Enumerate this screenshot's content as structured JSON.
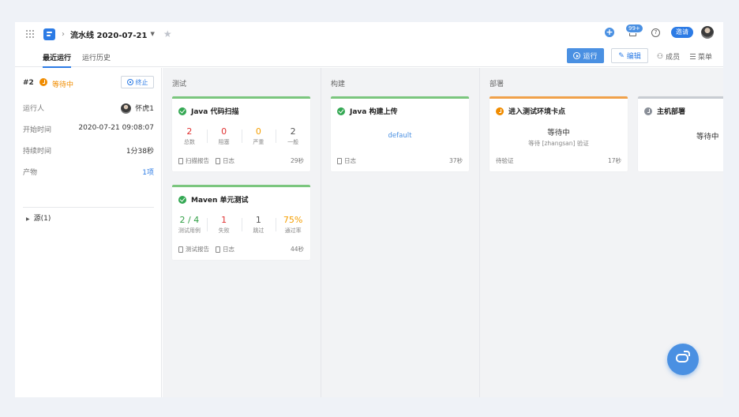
{
  "topbar": {
    "title": "流水线 2020-07-21",
    "notification_badge": "99+",
    "invite_label": "邀请"
  },
  "tabs": [
    {
      "label": "最近运行",
      "active": true
    },
    {
      "label": "运行历史",
      "active": false
    }
  ],
  "actions": {
    "run_label": "运行",
    "edit_label": "编辑",
    "members_label": "成员",
    "menu_label": "菜单"
  },
  "run": {
    "number": "#2",
    "status": "等待中",
    "stop_label": "终止",
    "info": [
      {
        "key": "运行人",
        "value": "怀虎1"
      },
      {
        "key": "开始时间",
        "value": "2020-07-21 09:08:07"
      },
      {
        "key": "持续时间",
        "value": "1分38秒"
      },
      {
        "key": "产物",
        "value": "1项"
      }
    ],
    "source_label": "源(1)"
  },
  "stages": [
    {
      "title": "测试",
      "jobs": [
        {
          "name": "Java 代码扫描",
          "stats": [
            {
              "value": "2",
              "label": "总数"
            },
            {
              "value": "0",
              "label": "阻塞"
            },
            {
              "value": "0",
              "label": "严重"
            },
            {
              "value": "2",
              "label": "一般"
            }
          ],
          "links": [
            "扫描报告",
            "日志"
          ],
          "duration": "29秒"
        },
        {
          "name": "Maven 单元测试",
          "stats": [
            {
              "value": "2 / 4",
              "label": "测试用例"
            },
            {
              "value": "1",
              "label": "失败"
            },
            {
              "value": "1",
              "label": "跳过"
            },
            {
              "value": "75%",
              "label": "通过率"
            }
          ],
          "links": [
            "测试报告",
            "日志"
          ],
          "duration": "44秒"
        }
      ]
    },
    {
      "title": "构建",
      "jobs": [
        {
          "name": "Java 构建上传",
          "center": "default",
          "links": [
            "日志"
          ],
          "duration": "37秒"
        }
      ]
    },
    {
      "title": "部署",
      "jobs": [
        {
          "name": "进入测试环境卡点",
          "status": "等待中",
          "sub": "等待 [zhangsan] 验证",
          "footer": "待验证",
          "duration": "17秒"
        },
        {
          "name": "主机部署",
          "status": "等待中"
        }
      ]
    }
  ],
  "colors": {
    "accent": "#2c7be5",
    "success": "#34a853",
    "warning": "#f08c00",
    "danger": "#e03131"
  }
}
